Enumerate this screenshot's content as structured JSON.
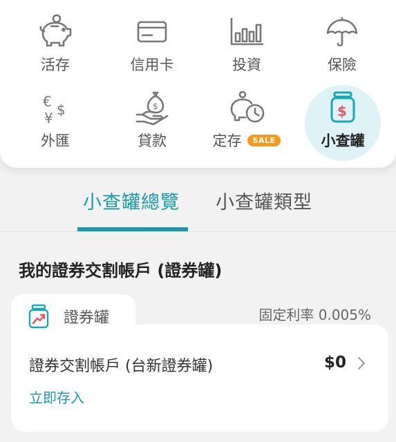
{
  "menu": {
    "items": [
      {
        "label": "活存",
        "icon": "piggy-bank-icon"
      },
      {
        "label": "信用卡",
        "icon": "credit-card-icon"
      },
      {
        "label": "投資",
        "icon": "bar-chart-icon"
      },
      {
        "label": "保險",
        "icon": "umbrella-icon"
      },
      {
        "label": "外匯",
        "icon": "currency-exchange-icon"
      },
      {
        "label": "貸款",
        "icon": "loan-hand-icon"
      },
      {
        "label": "定存",
        "icon": "piggy-clock-icon",
        "badge": "SALE"
      },
      {
        "label": "小查罐",
        "icon": "jar-icon",
        "active": true
      }
    ]
  },
  "tabs": [
    {
      "label": "小查罐總覽",
      "active": true
    },
    {
      "label": "小查罐類型",
      "active": false
    }
  ],
  "section": {
    "title": "我的證券交割帳戶 (證券罐)"
  },
  "card": {
    "tab_label": "證券罐",
    "rate_text": "固定利率 0.005%",
    "account_name": "證券交割帳戶 (台新證券罐)",
    "amount": "$0",
    "deposit_link": "立即存入"
  },
  "colors": {
    "accent": "#1a9aa7",
    "icon_gray": "#777777",
    "jar_teal": "#1aa7b4",
    "jar_red": "#e45a6a",
    "sale_orange": "#f39a1f",
    "active_bg": "#dff3f7"
  }
}
